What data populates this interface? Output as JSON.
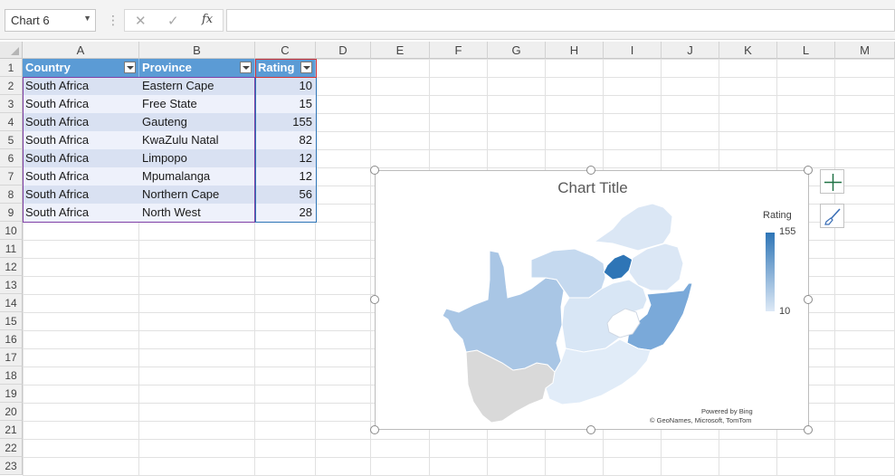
{
  "formula_bar": {
    "name_box": "Chart 6",
    "cancel_glyph": "✕",
    "enter_glyph": "✓",
    "fx_label": "fx",
    "formula": ""
  },
  "columns": [
    "A",
    "B",
    "C",
    "D",
    "E",
    "F",
    "G",
    "H",
    "I",
    "J",
    "K",
    "L",
    "M"
  ],
  "rows": [
    "1",
    "2",
    "3",
    "4",
    "5",
    "6",
    "7",
    "8",
    "9",
    "10",
    "11",
    "12",
    "13",
    "14",
    "15",
    "16",
    "17",
    "18",
    "19",
    "20",
    "21",
    "22",
    "23"
  ],
  "table": {
    "headers": [
      "Country",
      "Province",
      "Rating"
    ],
    "data": [
      [
        "South Africa",
        "Eastern Cape",
        "10"
      ],
      [
        "South Africa",
        "Free State",
        "15"
      ],
      [
        "South Africa",
        "Gauteng",
        "155"
      ],
      [
        "South Africa",
        "KwaZulu Natal",
        "82"
      ],
      [
        "South Africa",
        "Limpopo",
        "12"
      ],
      [
        "South Africa",
        "Mpumalanga",
        "12"
      ],
      [
        "South Africa",
        "Northern Cape",
        "56"
      ],
      [
        "South Africa",
        "North West",
        "28"
      ]
    ]
  },
  "chart": {
    "title": "Chart Title",
    "legend_title": "Rating",
    "legend_max": "155",
    "legend_min": "10",
    "attribution_1": "Powered by Bing",
    "attribution_2": "© GeoNames, Microsoft, TomTom",
    "region_colors": {
      "Limpopo": "#dbe7f5",
      "North West": "#c5d9ef",
      "Gauteng": "#2e75b6",
      "Mpumalanga": "#dbe7f5",
      "Northern Cape": "#a9c6e5",
      "Free State": "#d8e6f5",
      "KwaZulu Natal": "#7aa9d9",
      "Eastern Cape": "#e1ecf8",
      "Western Cape": "#d9d9d9",
      "Lesotho": "#ffffff"
    }
  },
  "colors": {
    "table_header": "#5b9bd5",
    "row_band_a": "#d9e1f2",
    "row_band_b": "#eef1fb",
    "excel_green": "#217346"
  }
}
